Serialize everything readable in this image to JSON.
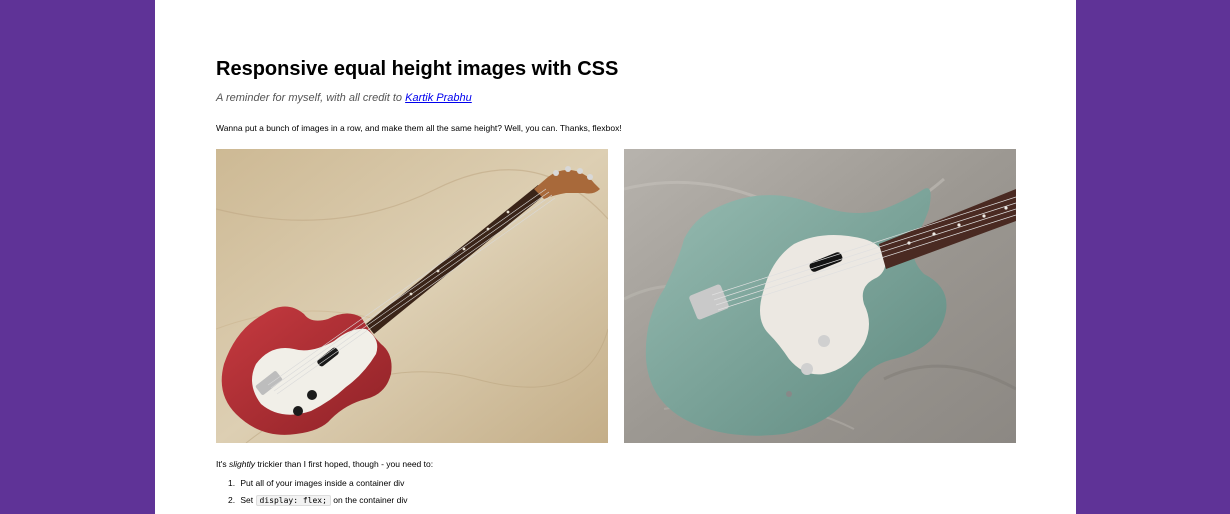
{
  "article": {
    "title": "Responsive equal height images with CSS",
    "subtitle_prefix": "A reminder for myself, with all credit to ",
    "subtitle_link": "Kartik Prabhu",
    "intro": "Wanna put a bunch of images in a row, and make them all the same height? Well, you can. Thanks, flexbox!",
    "tricky_pre": "It's ",
    "tricky_em": "slightly",
    "tricky_post": " trickier than I first hoped, though - you need to:",
    "steps": [
      {
        "num": "1.",
        "text": "Put all of your images inside a container div"
      },
      {
        "num": "2.",
        "pre": "Set ",
        "code": "display: flex;",
        "post": " on the container div"
      }
    ]
  },
  "images": [
    {
      "description_name": "red-bass-guitar-photo",
      "colors": {
        "body": "#b63238",
        "floor": "#d8c7a6"
      }
    },
    {
      "description_name": "teal-bass-guitar-photo",
      "colors": {
        "body": "#7fa79d",
        "cloth": "#a7a39e"
      }
    }
  ],
  "colors": {
    "background": "#5f3397",
    "page": "#ffffff",
    "link": "#0000ee"
  }
}
